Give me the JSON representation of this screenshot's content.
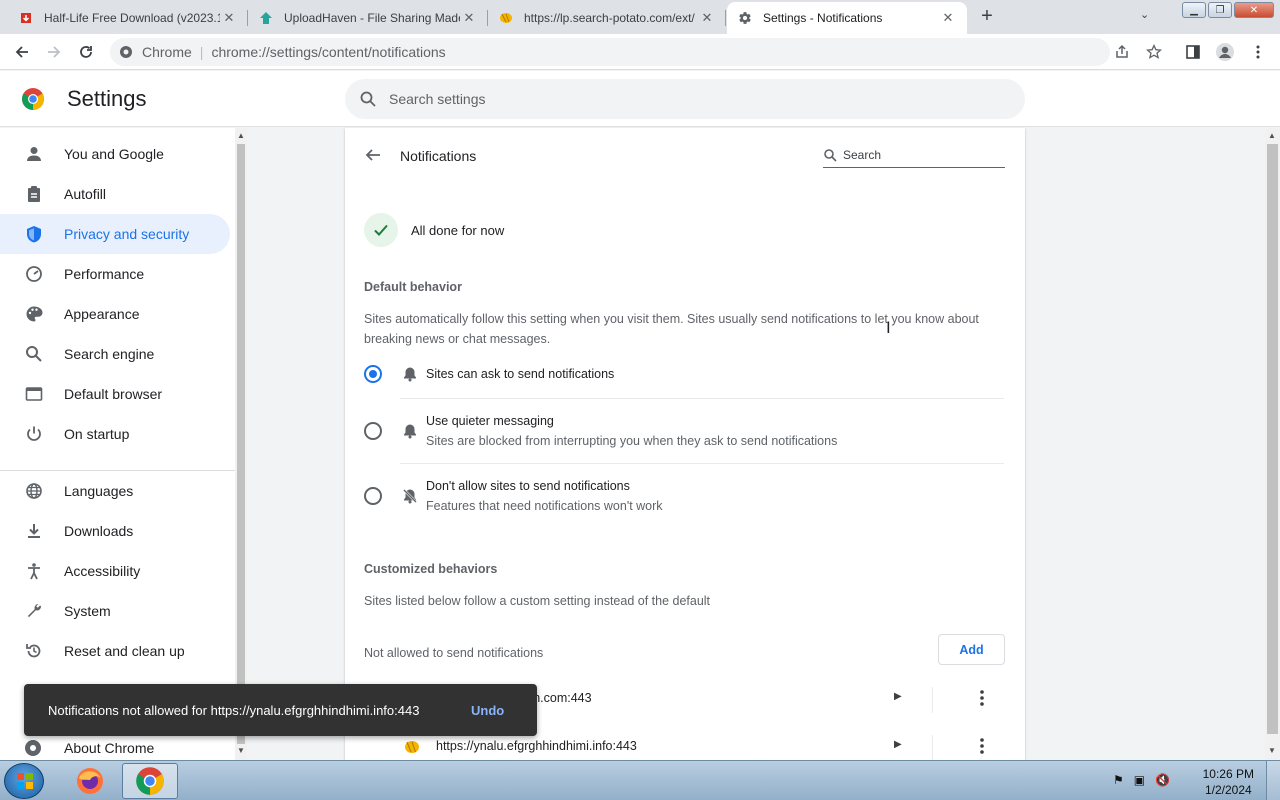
{
  "tabs": [
    {
      "title": "Half-Life Free Download (v2023.1",
      "favicon": "red-download-icon",
      "color": "#d93025"
    },
    {
      "title": "UploadHaven - File Sharing Made",
      "favicon": "uploadhaven-icon",
      "color": "#26a69a"
    },
    {
      "title": "https://lp.search-potato.com/ext/",
      "favicon": "potato-icon",
      "color": "#f4b400"
    },
    {
      "title": "Settings - Notifications",
      "favicon": "gear-icon",
      "active": true
    }
  ],
  "toolbar": {
    "omnibox_label": "Chrome",
    "omnibox_separator": "|",
    "url": "chrome://settings/content/notifications"
  },
  "settings": {
    "title": "Settings",
    "search_placeholder": "Search settings"
  },
  "sidebar": {
    "items": [
      {
        "label": "You and Google",
        "icon": "person-icon"
      },
      {
        "label": "Autofill",
        "icon": "clipboard-icon"
      },
      {
        "label": "Privacy and security",
        "icon": "shield-icon",
        "active": true
      },
      {
        "label": "Performance",
        "icon": "gauge-icon"
      },
      {
        "label": "Appearance",
        "icon": "palette-icon"
      },
      {
        "label": "Search engine",
        "icon": "search-icon"
      },
      {
        "label": "Default browser",
        "icon": "browser-window-icon"
      },
      {
        "label": "On startup",
        "icon": "power-icon"
      },
      {
        "label": "Languages",
        "icon": "globe-icon"
      },
      {
        "label": "Downloads",
        "icon": "download-icon"
      },
      {
        "label": "Accessibility",
        "icon": "accessibility-icon"
      },
      {
        "label": "System",
        "icon": "wrench-icon"
      },
      {
        "label": "Reset and clean up",
        "icon": "reset-icon"
      }
    ],
    "about": "About Chrome"
  },
  "main": {
    "page_title": "Notifications",
    "search_placeholder": "Search",
    "done_text": "All done for now",
    "default_title": "Default behavior",
    "default_desc": "Sites automatically follow this setting when you visit them. Sites usually send notifications to let you know about breaking news or chat messages.",
    "options": [
      {
        "label": "Sites can ask to send notifications",
        "sub": "",
        "selected": true,
        "icon": "bell-icon"
      },
      {
        "label": "Use quieter messaging",
        "sub": "Sites are blocked from interrupting you when they ask to send notifications",
        "selected": false,
        "icon": "bell-icon"
      },
      {
        "label": "Don't allow sites to send notifications",
        "sub": "Features that need notifications won't work",
        "selected": false,
        "icon": "bell-off-icon"
      }
    ],
    "custom_title": "Customized behaviors",
    "custom_desc": "Sites listed below follow a custom setting instead of the default",
    "not_allowed_label": "Not allowed to send notifications",
    "add_label": "Add",
    "sites": [
      {
        "url": "ven.com:443"
      },
      {
        "url": "https://ynalu.efgrghhindhimi.info:443"
      }
    ]
  },
  "toast": {
    "message": "Notifications not allowed for https://ynalu.efgrghhindhimi.info:443",
    "undo": "Undo"
  },
  "taskbar": {
    "time": "10:26 PM",
    "date": "1/2/2024"
  },
  "colors": {
    "accent": "#1a73e8",
    "active_bg": "#e8f0fe",
    "toast_bg": "#323232",
    "toast_action": "#8ab4f8"
  }
}
